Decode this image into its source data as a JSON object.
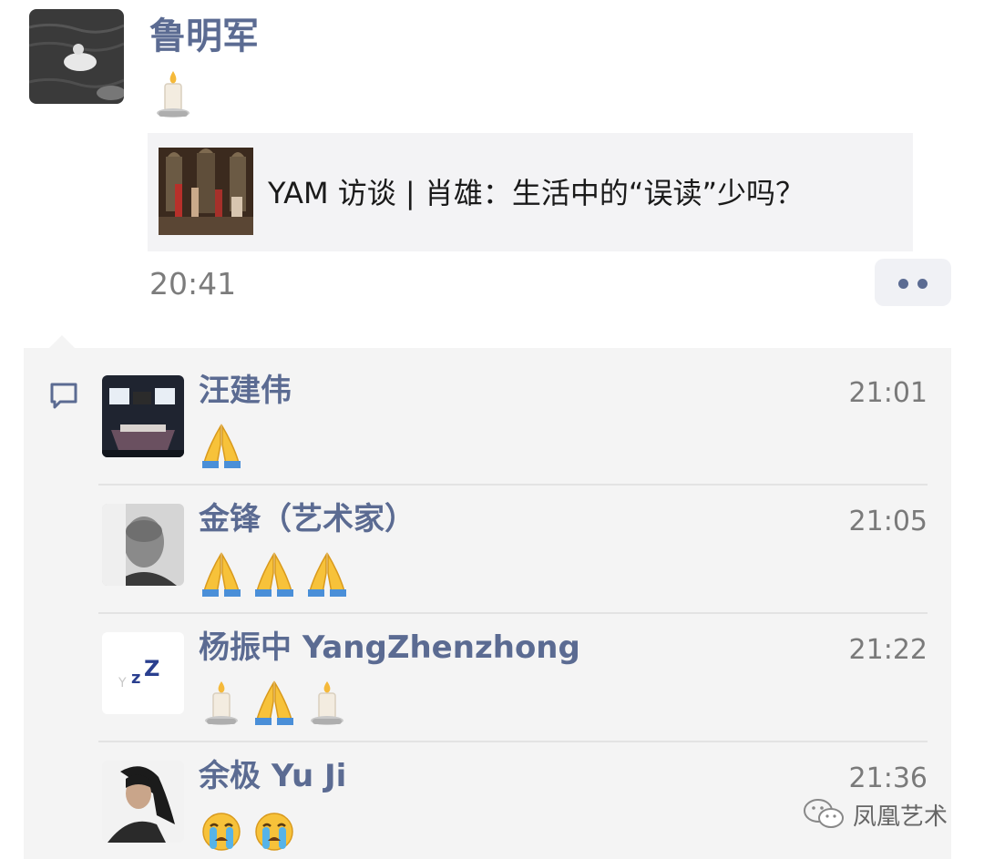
{
  "post": {
    "author": "鲁明军",
    "content_emoji": "candle-emoji",
    "link_card": {
      "title": "YAM 访谈 | 肖雄：生活中的“误读”少吗？"
    },
    "time": "20:41"
  },
  "comments": [
    {
      "name": "汪建伟",
      "time": "21:01",
      "emojis": [
        "folded-hands-emoji"
      ]
    },
    {
      "name": "金锋（艺术家）",
      "time": "21:05",
      "emojis": [
        "folded-hands-emoji",
        "folded-hands-emoji",
        "folded-hands-emoji"
      ]
    },
    {
      "name": "杨振中 YangZhenzhong",
      "time": "21:22",
      "emojis": [
        "candle-emoji",
        "folded-hands-emoji",
        "candle-emoji"
      ]
    },
    {
      "name": "余极 Yu Ji",
      "time": "21:36",
      "emojis": [
        "crying-face-emoji",
        "crying-face-emoji"
      ]
    }
  ],
  "watermark": {
    "text": "凤凰艺术"
  },
  "colors": {
    "name_blue": "#5b6b92",
    "panel_bg": "#f4f4f4",
    "time_gray": "#7c7c7c"
  }
}
